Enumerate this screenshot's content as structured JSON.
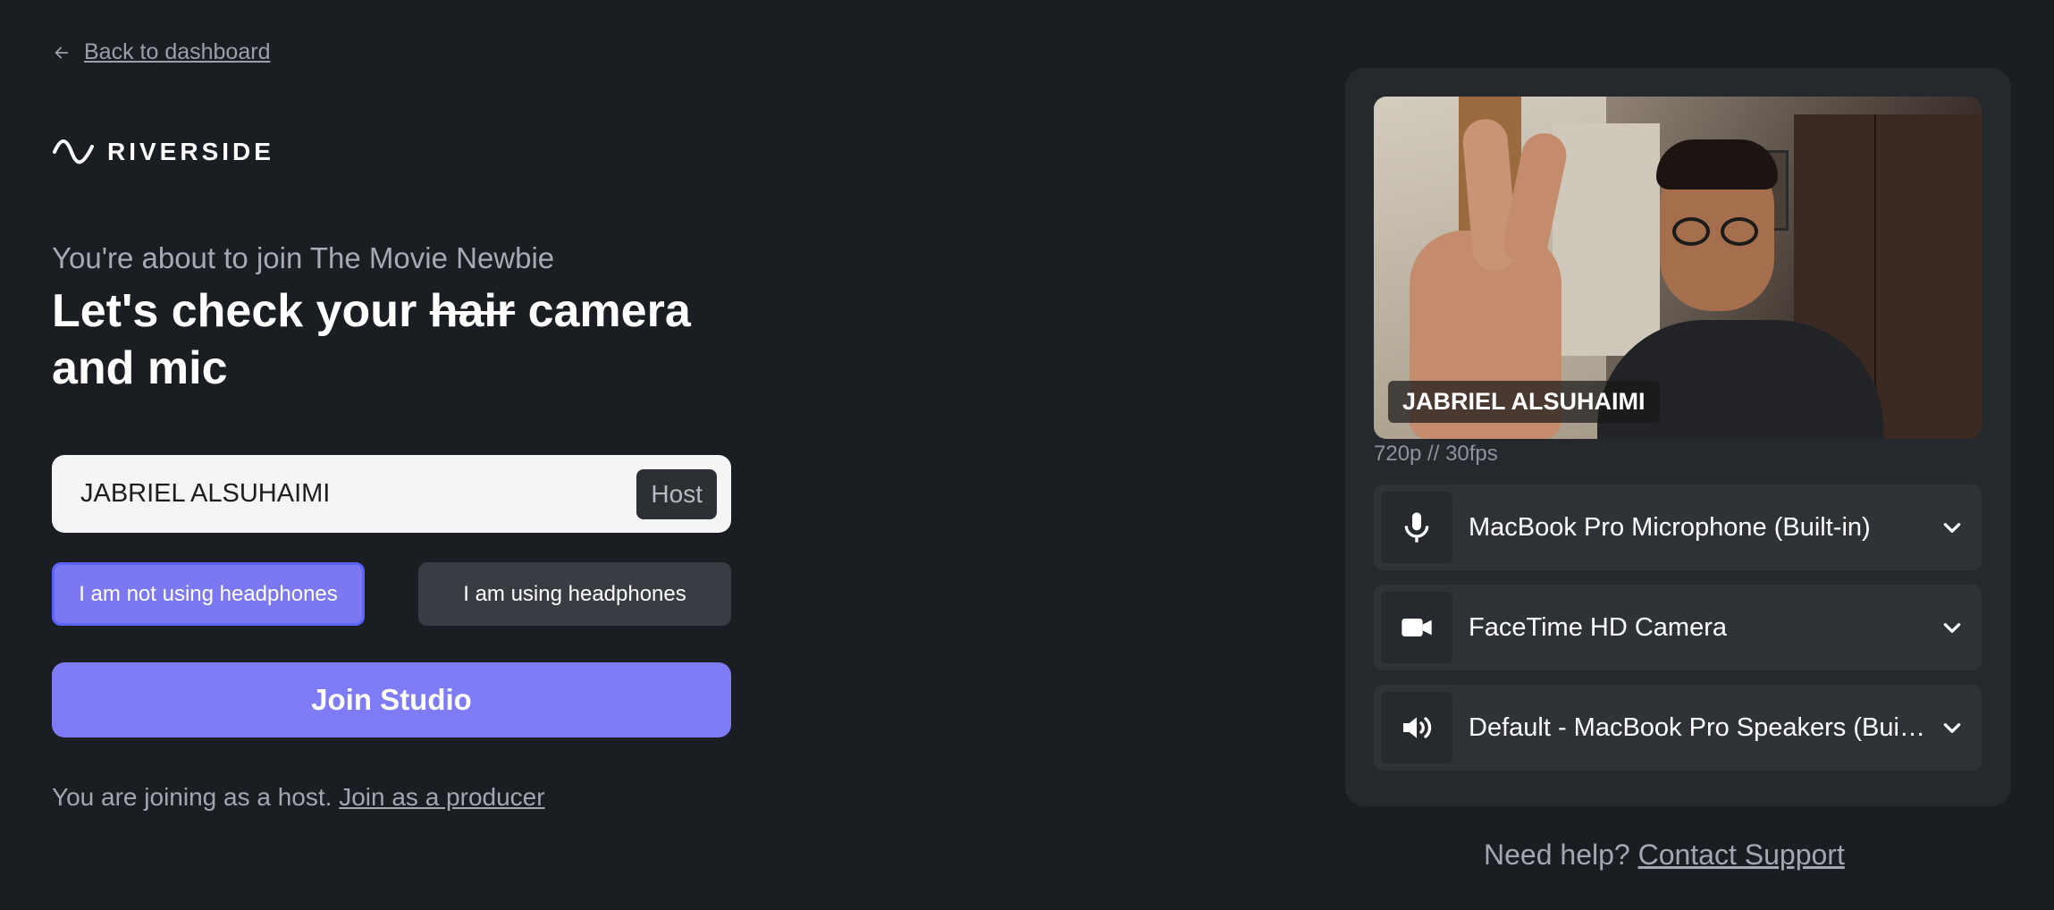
{
  "nav": {
    "back_label": "Back to dashboard"
  },
  "brand": {
    "name": "RIVERSIDE"
  },
  "intro": {
    "subtitle": "You're about to join The Movie Newbie",
    "title_before": "Let's check your ",
    "title_struck": "hair",
    "title_after": " camera and mic"
  },
  "name_field": {
    "value": "JABRIEL ALSUHAIMI",
    "role_badge": "Host"
  },
  "headphones": {
    "not_using_label": "I am not using headphones",
    "using_label": "I am using headphones",
    "selected": "not_using"
  },
  "join_button": {
    "label": "Join Studio"
  },
  "role_line": {
    "text": "You are joining as a host. ",
    "link": "Join as a producer"
  },
  "preview": {
    "name_tag": "JABRIEL ALSUHAIMI",
    "resolution": "720p // 30fps"
  },
  "devices": {
    "microphone": {
      "label": "MacBook Pro Microphone (Built-in)",
      "icon": "microphone-icon"
    },
    "camera": {
      "label": "FaceTime HD Camera",
      "icon": "camera-icon"
    },
    "speaker": {
      "label": "Default - MacBook Pro Speakers (Built-in)",
      "icon": "speaker-icon"
    }
  },
  "help": {
    "text": "Need help? ",
    "link": "Contact Support"
  },
  "colors": {
    "background": "#1a1d21",
    "panel": "#25282d",
    "accent": "#7f7bf5",
    "accent_border": "#5b63ff"
  }
}
